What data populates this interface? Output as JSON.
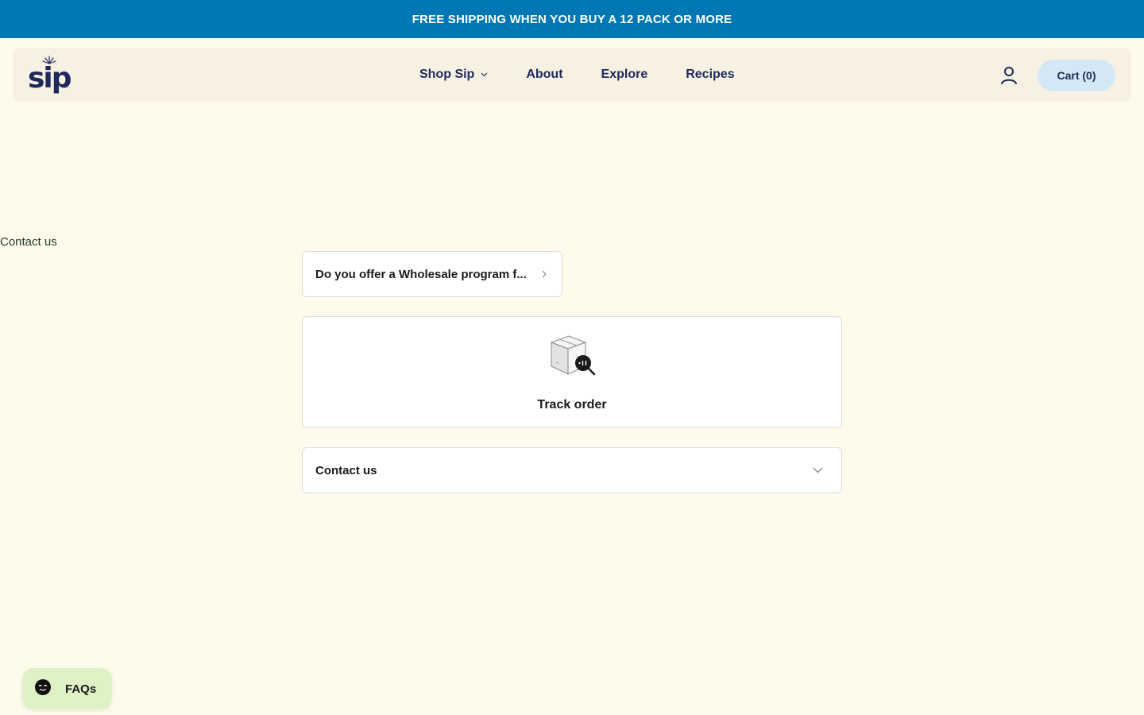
{
  "announcement": {
    "text": "FREE SHIPPING WHEN YOU BUY A 12 PACK OR MORE",
    "bg_color": "#0077b5"
  },
  "header": {
    "logo_text": "sip",
    "nav": [
      {
        "label": "Shop Sip",
        "has_dropdown": true
      },
      {
        "label": "About"
      },
      {
        "label": "Explore"
      },
      {
        "label": "Recipes"
      }
    ],
    "account_icon": "user-icon",
    "cart_label": "Cart (0)"
  },
  "page": {
    "contact_label": "Contact us",
    "faq_question": "Do you offer a Wholesale program f...",
    "track_order_label": "Track order",
    "contact_us_label": "Contact us"
  },
  "widget": {
    "label": "FAQs",
    "icon": "chat-icon"
  },
  "colors": {
    "page_bg": "#fffbec",
    "header_bg": "#f6f1e3",
    "brand_navy": "#1f2a5c",
    "cart_bg": "#d3e8f4",
    "widget_bg": "#dff2c6"
  }
}
